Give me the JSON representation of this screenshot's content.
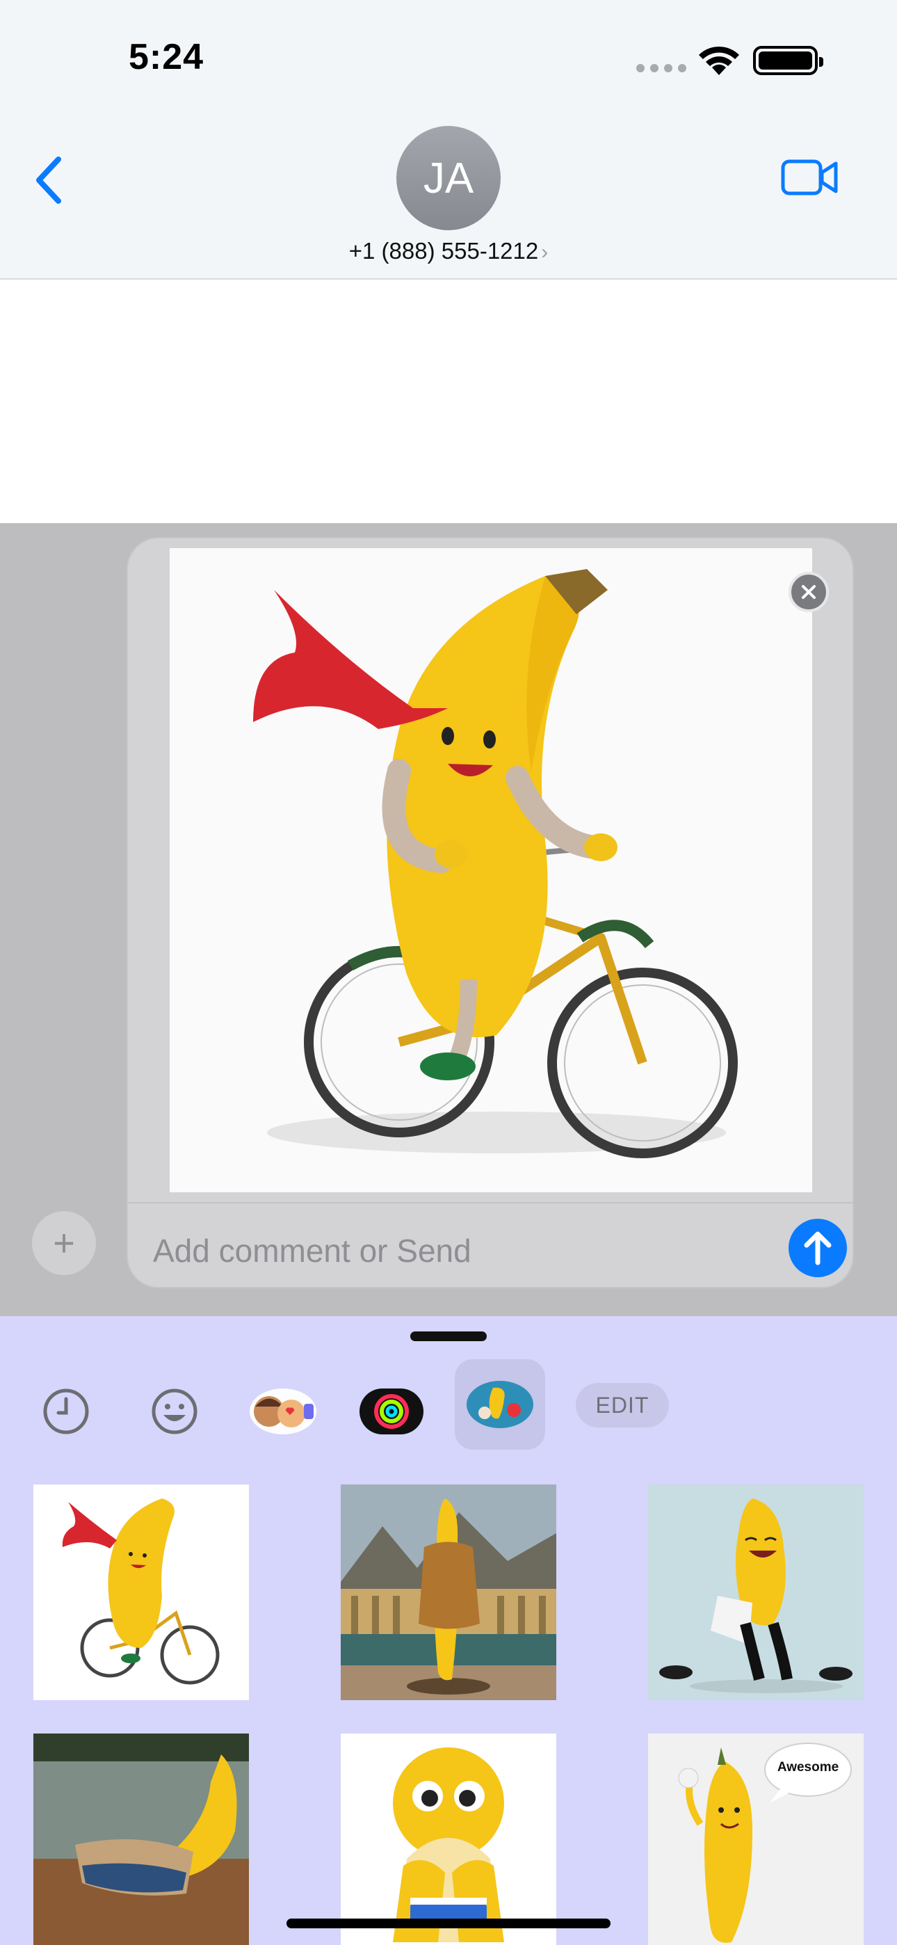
{
  "status": {
    "time": "5:24"
  },
  "header": {
    "avatar_initials": "JA",
    "contact_number": "+1 (888) 555-1212",
    "chevron": "›"
  },
  "composer": {
    "placeholder": "Add comment or Send",
    "plus_symbol": "+",
    "preview_sticker": "banana riding a bicycle"
  },
  "drawer": {
    "apps": [
      {
        "name": "recents-clock-icon"
      },
      {
        "name": "emoji-smiley-icon"
      },
      {
        "name": "memoji-stickers-icon"
      },
      {
        "name": "activity-rings-icon"
      },
      {
        "name": "banana-sticker-pack-icon",
        "selected": true
      }
    ],
    "edit_label": "EDIT",
    "stickers": [
      {
        "name": "sticker-banana-bicycle"
      },
      {
        "name": "sticker-banana-palace"
      },
      {
        "name": "sticker-banana-laughing"
      },
      {
        "name": "sticker-banana-lake"
      },
      {
        "name": "sticker-banana-cartoon"
      },
      {
        "name": "sticker-banana-awesome",
        "text": "Awesome"
      }
    ]
  },
  "colors": {
    "accent": "#0a7bff",
    "drawer_bg": "#d6d5fb",
    "banana": "#f5c518"
  }
}
